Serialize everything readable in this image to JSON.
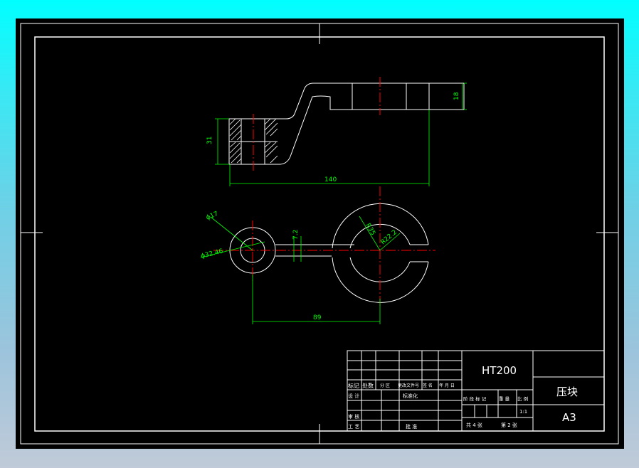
{
  "colors": {
    "background": "#000000",
    "geometry": "#ffffff",
    "centerline": "#ff0000",
    "dimension": "#00ff00",
    "frame_bg_top": "#00ffff",
    "frame_bg_bottom": "#c0cad8"
  },
  "drawing": {
    "dimensions": {
      "length_140": "140",
      "height_31": "31",
      "height_18": "18",
      "dia_17": "ϕ17",
      "dia_32_46": "ϕ32.46",
      "width_7_2": "7.2",
      "radius_35": "R35",
      "radius_22_2": "R22.2",
      "center_89": "89"
    }
  },
  "title_block": {
    "material": "HT200",
    "part_name": "压块",
    "sheet_size": "A3",
    "scale": "1:1",
    "left_row_labels": {
      "r1_c1": "标记",
      "r1_c2": "处数",
      "r1_c3": "分 区",
      "r1_c4": "更改文件号",
      "r1_c5": "签 名",
      "r1_c6": "年 月 日",
      "r2_c1": "设 计",
      "r2_c2": "标准化",
      "r3_c1": "审 核",
      "r4_c1": "工 艺",
      "r4_c2": "批 准"
    },
    "right_row_labels": {
      "stage_mark": "阶 段 标 记",
      "weight": "重 量",
      "ratio": "比 例",
      "sheets_total": "共 4 张",
      "sheet_no": "第 2 张"
    }
  }
}
